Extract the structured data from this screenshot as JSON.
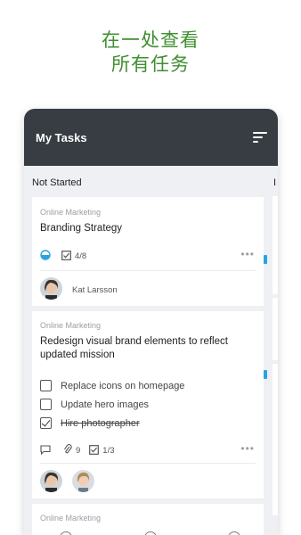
{
  "headline": {
    "line1": "在一处查看",
    "line2": "所有任务"
  },
  "appbar": {
    "title": "My Tasks",
    "sort_icon": "sort-icon"
  },
  "columns": [
    {
      "label": "Not Started"
    },
    {
      "label": "I"
    }
  ],
  "cards": [
    {
      "category": "Online Marketing",
      "title": "Branding Strategy",
      "checklist_count": "4/8",
      "progress_fraction": 0.5,
      "assignee": "Kat Larsson"
    },
    {
      "category": "Online Marketing",
      "title": "Redesign visual brand elements to reflect updated mission",
      "checklist": [
        {
          "label": "Replace icons on homepage",
          "done": false
        },
        {
          "label": "Update hero images",
          "done": false
        },
        {
          "label": "Hire photographer",
          "done": true
        }
      ],
      "attachments": "9",
      "checklist_count": "1/3"
    },
    {
      "category": "Online Marketing"
    }
  ],
  "colors": {
    "accent_green": "#3f8f2f",
    "appbar": "#373d43",
    "progress_blue": "#2aa3e0"
  }
}
